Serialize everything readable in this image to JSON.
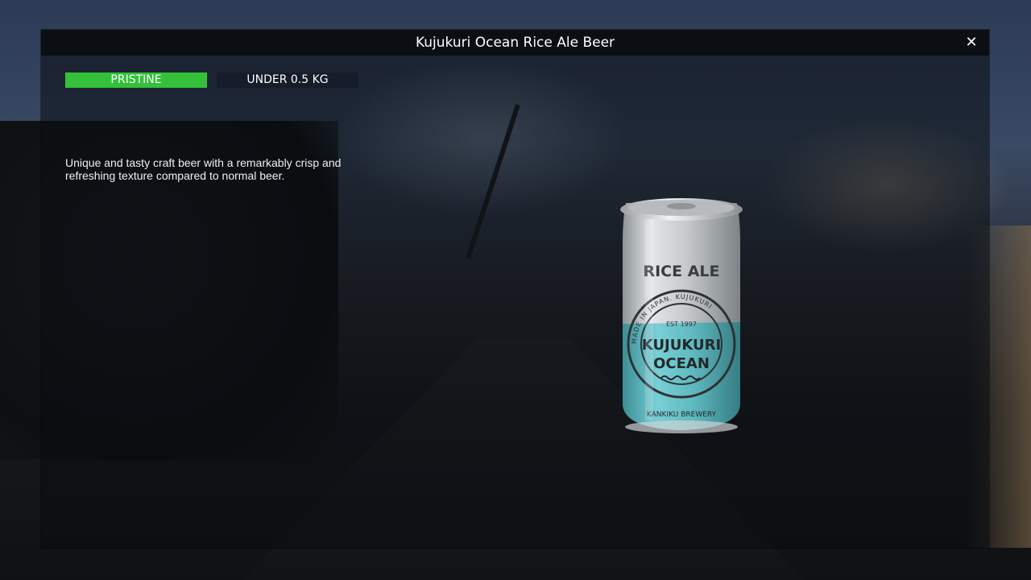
{
  "item": {
    "title": "Kujukuri Ocean Rice Ale Beer",
    "condition_tag": "PRISTINE",
    "weight_tag": "UNDER 0.5 KG",
    "description": "Unique and tasty craft beer with a remarkably crisp and refreshing texture compared to normal beer."
  },
  "window": {
    "close_icon": "close-icon"
  },
  "product_label": {
    "top_text": "RICE ALE",
    "est": "EST 1997",
    "brand_line1": "KUJUKURI",
    "brand_line2": "OCEAN",
    "ring_text": "MADE IN JAPAN. KUJUKURI",
    "brewery": "KANKIKU BREWERY"
  },
  "colors": {
    "condition_green": "#33c13a",
    "weight_tag_bg": "#151c2a",
    "can_teal": "#5fb9c0",
    "can_silver": "#c9cdd0"
  }
}
